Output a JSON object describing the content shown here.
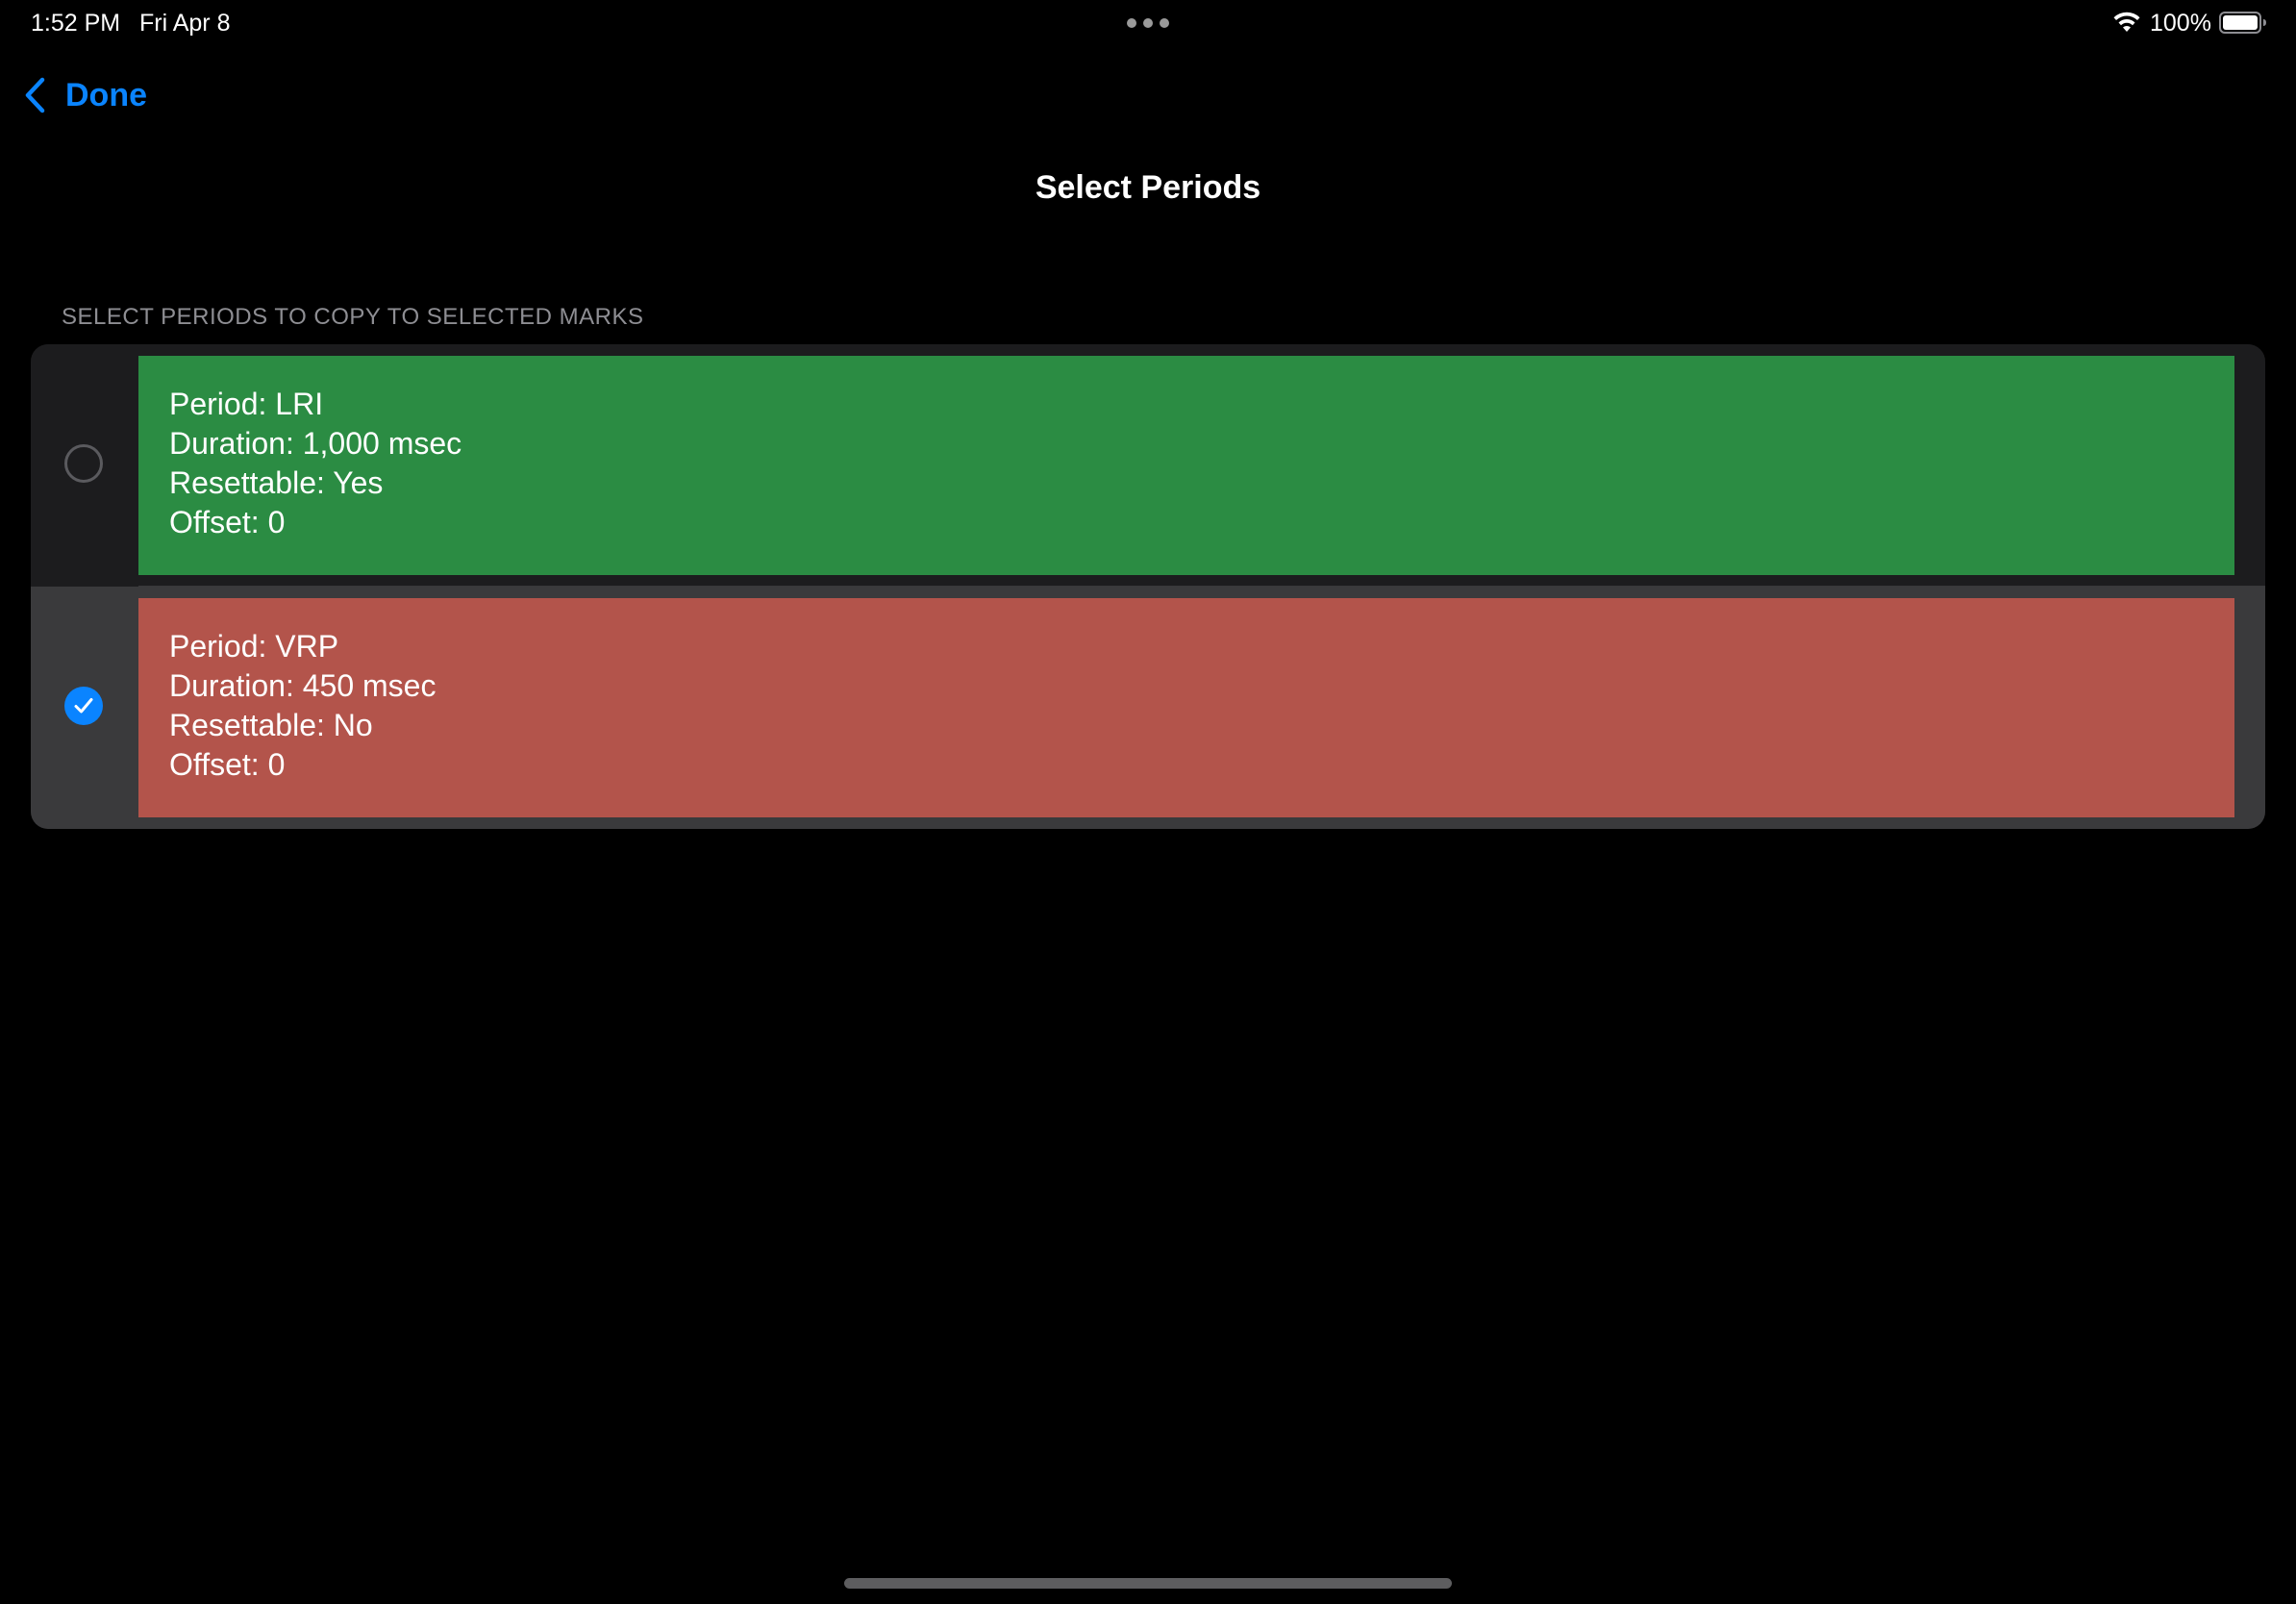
{
  "status_bar": {
    "time": "1:52 PM",
    "date": "Fri Apr 8",
    "battery_percent": "100%",
    "wifi_icon": "wifi-icon",
    "battery_icon": "battery-full-icon"
  },
  "nav": {
    "back_label": "Done",
    "back_icon": "chevron-left-icon",
    "title": "Select Periods"
  },
  "section": {
    "header": "SELECT PERIODS TO COPY TO SELECTED MARKS"
  },
  "periods": [
    {
      "period": "Period: LRI",
      "duration": "Duration: 1,000 msec",
      "resettable": "Resettable: Yes",
      "offset": "Offset: 0",
      "color": "#2b8c43",
      "selected": false
    },
    {
      "period": "Period: VRP",
      "duration": "Duration: 450 msec",
      "resettable": "Resettable: No",
      "offset": "Offset: 0",
      "color": "#b3544b",
      "selected": true
    }
  ],
  "colors": {
    "accent": "#0a84ff",
    "background": "#000000",
    "list_background": "#1c1c1e",
    "selected_row_background": "#3a3a3c"
  }
}
